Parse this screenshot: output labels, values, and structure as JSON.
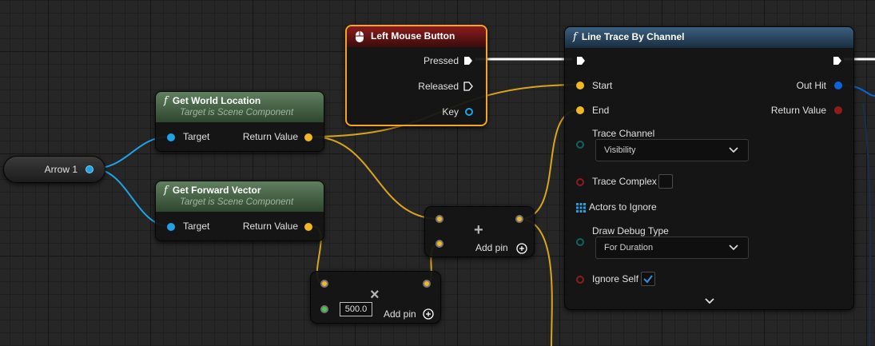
{
  "colors": {
    "vector_pin": "#f1b823",
    "object_pin": "#1ea3e8",
    "bool_pin": "#8e1c1c",
    "struct_pin": "#0b64d8",
    "enum_pin": "#10625e",
    "float_pin": "#3dd14a",
    "exec": "#ffffff",
    "selected_outline": "#f7a51c"
  },
  "arrow_node": {
    "label": "Arrow 1"
  },
  "get_world_location": {
    "title": "Get World Location",
    "subtitle": "Target is Scene Component",
    "target_label": "Target",
    "return_label": "Return Value",
    "icon": "function-icon"
  },
  "get_forward_vector": {
    "title": "Get Forward Vector",
    "subtitle": "Target is Scene Component",
    "target_label": "Target",
    "return_label": "Return Value",
    "icon": "function-icon"
  },
  "left_mouse_button": {
    "title": "Left Mouse Button",
    "pressed_label": "Pressed",
    "released_label": "Released",
    "key_label": "Key",
    "icon": "mouse-icon"
  },
  "add_node": {
    "operator": "+",
    "add_pin_label": "Add pin"
  },
  "multiply_node": {
    "operator": "×",
    "value": "500.0",
    "add_pin_label": "Add pin"
  },
  "line_trace": {
    "title": "Line Trace By Channel",
    "icon": "function-icon",
    "start_label": "Start",
    "end_label": "End",
    "trace_channel_label": "Trace Channel",
    "trace_channel_value": "Visibility",
    "trace_complex_label": "Trace Complex",
    "actors_to_ignore_label": "Actors to Ignore",
    "draw_debug_type_label": "Draw Debug Type",
    "draw_debug_type_value": "For Duration",
    "ignore_self_label": "Ignore Self",
    "out_hit_label": "Out Hit",
    "return_value_label": "Return Value",
    "trace_complex_checked": false,
    "ignore_self_checked": true
  }
}
